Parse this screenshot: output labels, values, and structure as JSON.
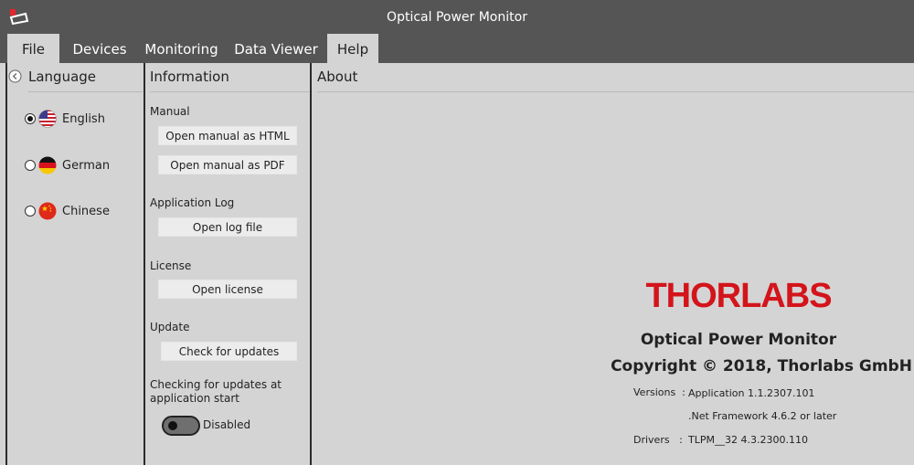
{
  "window": {
    "title": "Optical Power Monitor"
  },
  "menu": {
    "items": [
      {
        "label": "File"
      },
      {
        "label": "Devices"
      },
      {
        "label": "Monitoring"
      },
      {
        "label": "Data Viewer"
      },
      {
        "label": "Help"
      }
    ]
  },
  "language": {
    "header": "Language",
    "options": [
      {
        "label": "English",
        "selected": true,
        "flag": "us-flag-icon"
      },
      {
        "label": "German",
        "selected": false,
        "flag": "de-flag-icon"
      },
      {
        "label": "Chinese",
        "selected": false,
        "flag": "cn-flag-icon"
      }
    ]
  },
  "information": {
    "header": "Information",
    "manual": {
      "label": "Manual",
      "html_button": "Open manual as HTML",
      "pdf_button": "Open manual as PDF"
    },
    "log": {
      "label": "Application Log",
      "button": "Open log file"
    },
    "license": {
      "label": "License",
      "button": "Open license"
    },
    "update": {
      "label": "Update",
      "button": "Check for updates"
    },
    "startup_check": {
      "label": "Checking for updates at application start",
      "toggle_label": "Disabled",
      "enabled": false
    }
  },
  "about": {
    "header": "About",
    "logo": "THORLABS",
    "product": "Optical Power Monitor",
    "copyright": "Copyright © 2018, Thorlabs GmbH",
    "versions_label": "Versions",
    "application_version": "Application 1.1.2307.101",
    "framework": ".Net Framework 4.6.2 or later",
    "drivers_label": "Drivers",
    "driver_version": "TLPM__32 4.3.2300.110"
  },
  "colors": {
    "titlebar": "#555555",
    "background": "#d4d4d4",
    "logo_red": "#d3141b",
    "button": "#ececec"
  }
}
